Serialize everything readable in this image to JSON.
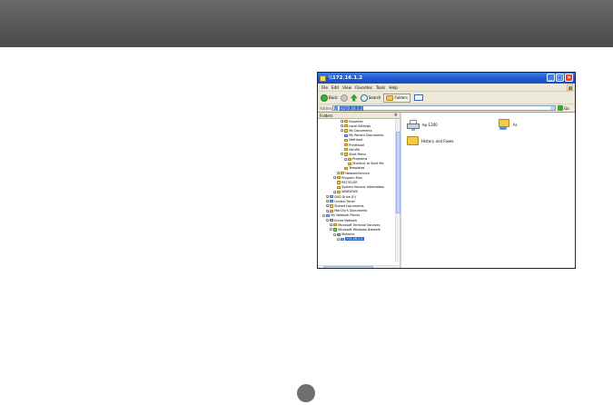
{
  "colors": {
    "header_bar": "#555555",
    "titlebar": "#1f58d0",
    "selection": "#316ac5",
    "page_dot": "#6f6f6f"
  },
  "window": {
    "title": "\\\\172.16.1.2",
    "menu": [
      "File",
      "Edit",
      "View",
      "Favorites",
      "Tools",
      "Help"
    ],
    "toolbar": {
      "back_label": "Back",
      "search_label": "Search",
      "folders_label": "Folders"
    },
    "address": {
      "label": "Address",
      "value": "\\\\172.16.1.2",
      "go_label": "Go"
    },
    "folders_pane": {
      "title": "Folders",
      "tree": [
        {
          "label": "Favorites",
          "indent": 6,
          "exp": "+",
          "icon": "folder"
        },
        {
          "label": "Local Settings",
          "indent": 6,
          "exp": "+",
          "icon": "folder"
        },
        {
          "label": "My Documents",
          "indent": 6,
          "exp": "+",
          "icon": "folder"
        },
        {
          "label": "My Recent Documents",
          "indent": 6,
          "exp": "",
          "icon": "blue"
        },
        {
          "label": "NetHood",
          "indent": 6,
          "exp": "",
          "icon": "folder"
        },
        {
          "label": "PrintHood",
          "indent": 6,
          "exp": "",
          "icon": "folder"
        },
        {
          "label": "SendTo",
          "indent": 6,
          "exp": "",
          "icon": "folder"
        },
        {
          "label": "Start Menu",
          "indent": 6,
          "exp": "-",
          "icon": "folder"
        },
        {
          "label": "Programs",
          "indent": 7,
          "exp": "+",
          "icon": "folder"
        },
        {
          "label": "Shortcut to Start Me",
          "indent": 7,
          "exp": "",
          "icon": "folder"
        },
        {
          "label": "Templates",
          "indent": 6,
          "exp": "",
          "icon": "folder"
        },
        {
          "label": "NetworkService",
          "indent": 5,
          "exp": "+",
          "icon": "folder"
        },
        {
          "label": "Program Files",
          "indent": 4,
          "exp": "+",
          "icon": "folder"
        },
        {
          "label": "RECYCLER",
          "indent": 4,
          "exp": "",
          "icon": "folder"
        },
        {
          "label": "System Volume Information",
          "indent": 4,
          "exp": "",
          "icon": "folder"
        },
        {
          "label": "WINDOWS",
          "indent": 4,
          "exp": "+",
          "icon": "folder"
        },
        {
          "label": "DVD Drive (F:)",
          "indent": 2,
          "exp": "+",
          "icon": "blue"
        },
        {
          "label": "Control Panel",
          "indent": 2,
          "exp": "+",
          "icon": "blue"
        },
        {
          "label": "Shared Documents",
          "indent": 2,
          "exp": "+",
          "icon": "folder"
        },
        {
          "label": "MarChy's Documents",
          "indent": 2,
          "exp": "+",
          "icon": "folder"
        },
        {
          "label": "My Network Places",
          "indent": 1,
          "exp": "-",
          "icon": "blue"
        },
        {
          "label": "Entire Network",
          "indent": 2,
          "exp": "-",
          "icon": "green"
        },
        {
          "label": "Microsoft Terminal Services",
          "indent": 3,
          "exp": "+",
          "icon": "folder"
        },
        {
          "label": "Microsoft Windows Network",
          "indent": 3,
          "exp": "-",
          "icon": "green"
        },
        {
          "label": "Mshome",
          "indent": 4,
          "exp": "-",
          "icon": "green"
        },
        {
          "label": "172.16.1.2",
          "indent": 5,
          "exp": "+",
          "icon": "blue",
          "selected": true
        }
      ]
    },
    "files": [
      {
        "label": "hp-1200",
        "icon": "printer-icon"
      },
      {
        "label": "hs",
        "icon": "shared-folder-icon"
      },
      {
        "label": "History and Faxes",
        "icon": "folder-icon"
      }
    ]
  }
}
